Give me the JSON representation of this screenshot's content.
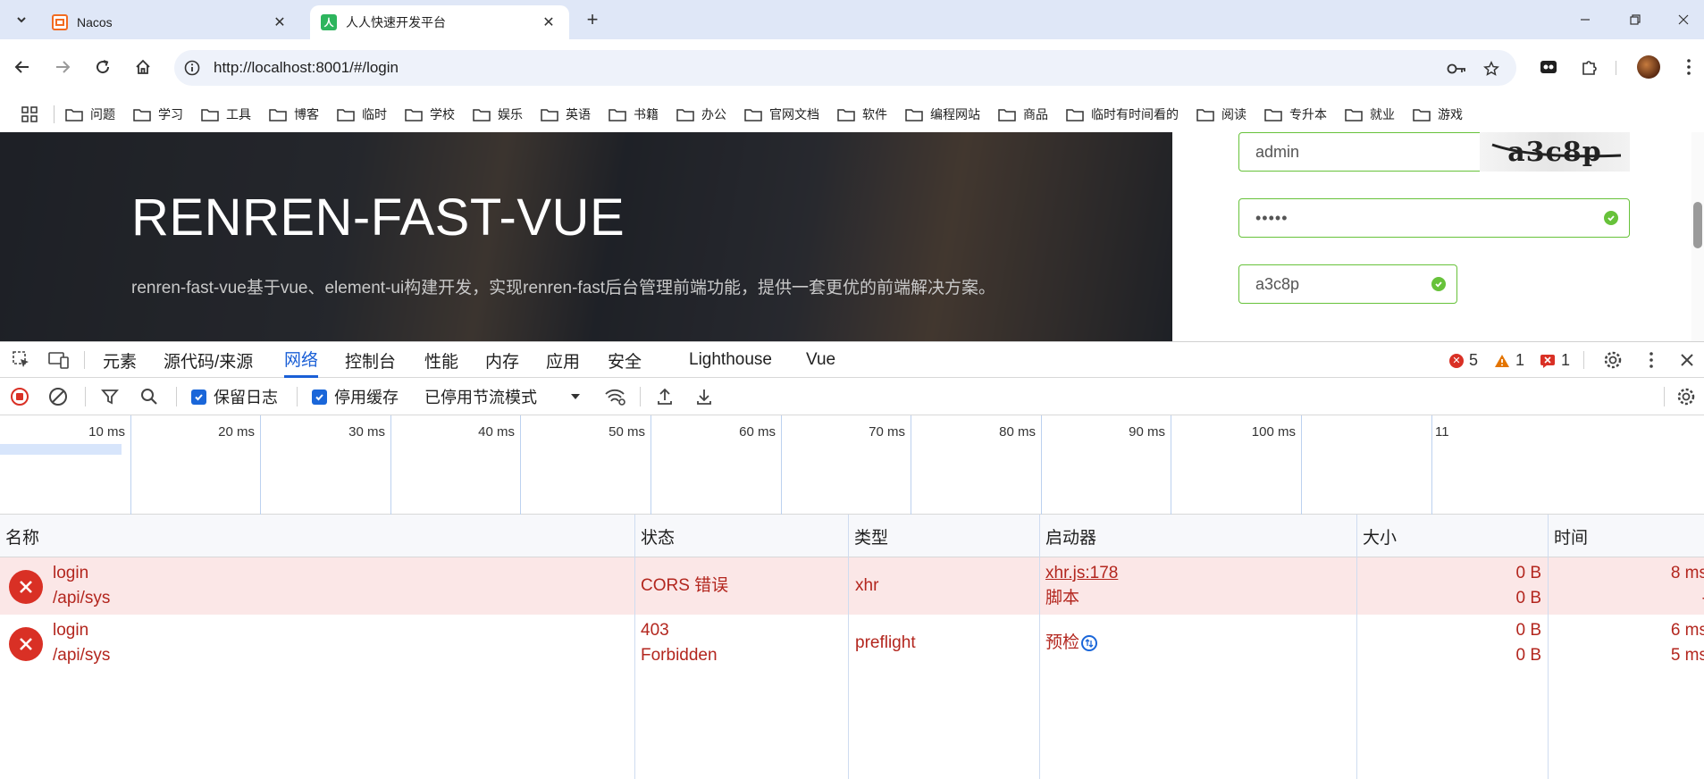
{
  "tabs": [
    {
      "title": "Nacos",
      "favicon": "nacos-icon",
      "active": false
    },
    {
      "title": "人人快速开发平台",
      "favicon": "renren-icon",
      "favicon_text": "人",
      "active": true
    }
  ],
  "address_bar": {
    "url": "http://localhost:8001/#/login"
  },
  "bookmarks": [
    "问题",
    "学习",
    "工具",
    "博客",
    "临时",
    "学校",
    "娱乐",
    "英语",
    "书籍",
    "办公",
    "官网文档",
    "软件",
    "编程网站",
    "商品",
    "临时有时间看的",
    "阅读",
    "专升本",
    "就业",
    "游戏"
  ],
  "page": {
    "hero_title": "RENREN-FAST-VUE",
    "hero_desc": "renren-fast-vue基于vue、element-ui构建开发，实现renren-fast后台管理前端功能，提供一套更优的前端解决方案。",
    "username": "admin",
    "password": "•••••",
    "captcha_input": "a3c8p",
    "captcha_image_text": "a3c8p"
  },
  "devtools": {
    "tabs": [
      "元素",
      "源代码/来源",
      "网络",
      "控制台",
      "性能",
      "内存",
      "应用",
      "安全",
      "Lighthouse",
      "Vue"
    ],
    "active_tab": "网络",
    "errors": "5",
    "warnings": "1",
    "issues": "1",
    "toolbar": {
      "preserve_log": "保留日志",
      "disable_cache": "停用缓存",
      "throttling": "已停用节流模式"
    },
    "timeline_ticks": [
      "10 ms",
      "20 ms",
      "30 ms",
      "40 ms",
      "50 ms",
      "60 ms",
      "70 ms",
      "80 ms",
      "90 ms",
      "100 ms",
      "11"
    ],
    "columns": [
      "名称",
      "状态",
      "类型",
      "启动器",
      "大小",
      "时间"
    ],
    "requests": [
      {
        "name": "login",
        "path": "/api/sys",
        "status_1": "CORS 错误",
        "status_2": "",
        "type": "xhr",
        "initiator_1": "xhr.js:178",
        "initiator_2": "脚本",
        "size_1": "0 B",
        "size_2": "0 B",
        "time_1": "8 ms",
        "time_2": "-"
      },
      {
        "name": "login",
        "path": "/api/sys",
        "status_1": "403",
        "status_2": "Forbidden",
        "type": "preflight",
        "initiator_1": "预检",
        "initiator_2": "",
        "size_1": "0 B",
        "size_2": "0 B",
        "time_1": "6 ms",
        "time_2": "5 ms"
      }
    ]
  },
  "colors": {
    "accent": "#1a5fd6",
    "error": "#d93025",
    "success": "#67c23a",
    "error_row": "#fbe7e7"
  }
}
